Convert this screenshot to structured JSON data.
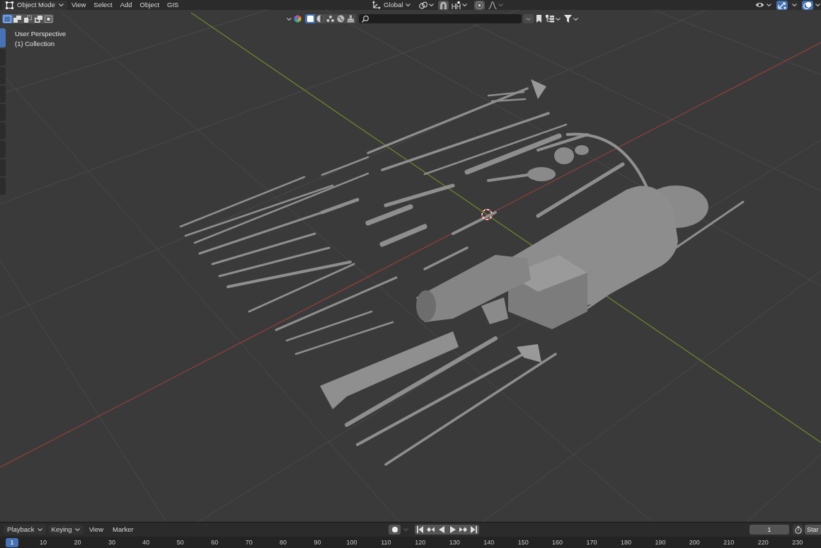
{
  "header": {
    "mode_menu": {
      "label": "Object Mode"
    },
    "menus": [
      "View",
      "Select",
      "Add",
      "Object",
      "GIS"
    ],
    "orientation_menu": {
      "label": "Global"
    },
    "gizmos": {
      "on": true
    },
    "overlays": {
      "on": true
    }
  },
  "selection_modes": [
    {
      "selected": true
    },
    {
      "selected": false
    },
    {
      "selected": false
    },
    {
      "selected": false
    },
    {
      "selected": false
    }
  ],
  "filter_bar": {
    "modes": [
      {
        "selected": true
      },
      {
        "selected": false
      },
      {
        "selected": false
      },
      {
        "selected": false
      },
      {
        "selected": false
      }
    ]
  },
  "toolbar": {
    "tools": [
      {
        "selected": true
      },
      {
        "selected": false
      },
      {
        "selected": false
      },
      {
        "selected": false
      },
      {
        "selected": false
      },
      {
        "selected": false
      },
      {
        "selected": false
      },
      {
        "selected": false
      },
      {
        "selected": false
      }
    ]
  },
  "viewport": {
    "view_name": "User Perspective",
    "collection": "(1) Collection"
  },
  "timeline": {
    "menus": [
      {
        "label": "Playback",
        "dropdown": true
      },
      {
        "label": "Keying",
        "dropdown": true
      },
      {
        "label": "View",
        "dropdown": false
      },
      {
        "label": "Marker",
        "dropdown": false
      }
    ],
    "current_frame": "1",
    "start_field": "Star",
    "frames": [
      {
        "label": "1",
        "selected": true
      },
      {
        "label": "10",
        "selected": false
      },
      {
        "label": "20",
        "selected": false
      },
      {
        "label": "30",
        "selected": false
      },
      {
        "label": "40",
        "selected": false
      },
      {
        "label": "50",
        "selected": false
      },
      {
        "label": "60",
        "selected": false
      },
      {
        "label": "70",
        "selected": false
      },
      {
        "label": "80",
        "selected": false
      },
      {
        "label": "90",
        "selected": false
      },
      {
        "label": "100",
        "selected": false
      },
      {
        "label": "110",
        "selected": false
      },
      {
        "label": "120",
        "selected": false
      },
      {
        "label": "130",
        "selected": false
      },
      {
        "label": "140",
        "selected": false
      },
      {
        "label": "150",
        "selected": false
      },
      {
        "label": "160",
        "selected": false
      },
      {
        "label": "170",
        "selected": false
      },
      {
        "label": "180",
        "selected": false
      },
      {
        "label": "190",
        "selected": false
      },
      {
        "label": "200",
        "selected": false
      },
      {
        "label": "210",
        "selected": false
      },
      {
        "label": "220",
        "selected": false
      },
      {
        "label": "230",
        "selected": false
      }
    ]
  }
}
